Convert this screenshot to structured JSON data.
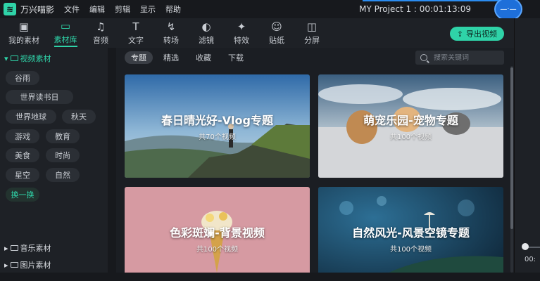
{
  "app": {
    "name": "万兴喵影",
    "logo_glyph": "≋"
  },
  "menu": [
    "文件",
    "编辑",
    "剪辑",
    "显示",
    "帮助"
  ],
  "project": {
    "label": "MY Project 1 : 00:01:13:09"
  },
  "toolbar": {
    "items": [
      {
        "label": "我的素材",
        "icon": "folder-icon",
        "glyph": "▣"
      },
      {
        "label": "素材库",
        "icon": "library-icon",
        "glyph": "▭"
      },
      {
        "label": "音频",
        "icon": "music-note-icon",
        "glyph": "♫"
      },
      {
        "label": "文字",
        "icon": "text-icon",
        "glyph": "T"
      },
      {
        "label": "转场",
        "icon": "transition-icon",
        "glyph": "↯"
      },
      {
        "label": "滤镜",
        "icon": "filter-icon",
        "glyph": "◐"
      },
      {
        "label": "特效",
        "icon": "effects-icon",
        "glyph": "✦"
      },
      {
        "label": "贴纸",
        "icon": "sticker-icon",
        "glyph": "☺"
      },
      {
        "label": "分屏",
        "icon": "split-screen-icon",
        "glyph": "◫"
      }
    ],
    "active_index": 1,
    "export_label": "导出视频"
  },
  "sidebar": {
    "heading": "视频素材",
    "tags": [
      "谷雨",
      "世界读书日",
      "世界地球",
      "秋天",
      "游戏",
      "教育",
      "美食",
      "时尚",
      "星空",
      "自然"
    ],
    "refresh_label": "换一换",
    "folders": [
      "音乐素材",
      "图片素材"
    ]
  },
  "main": {
    "tabs": [
      "专题",
      "精选",
      "收藏",
      "下载"
    ],
    "active_tab": 0,
    "search_placeholder": "搜索关键词",
    "cards": [
      {
        "title": "春日晴光好-Vlog专题",
        "count": "共70个视频"
      },
      {
        "title": "萌宠乐园-宠物专题",
        "count": "共100个视频"
      },
      {
        "title": "色彩斑斓-背景视频",
        "count": "共100个视频"
      },
      {
        "title": "自然风光-风景空镜专题",
        "count": "共100个视频"
      }
    ]
  },
  "right": {
    "time": "00:"
  },
  "colors": {
    "accent": "#2fd3a8",
    "bg": "#1b1e23"
  }
}
